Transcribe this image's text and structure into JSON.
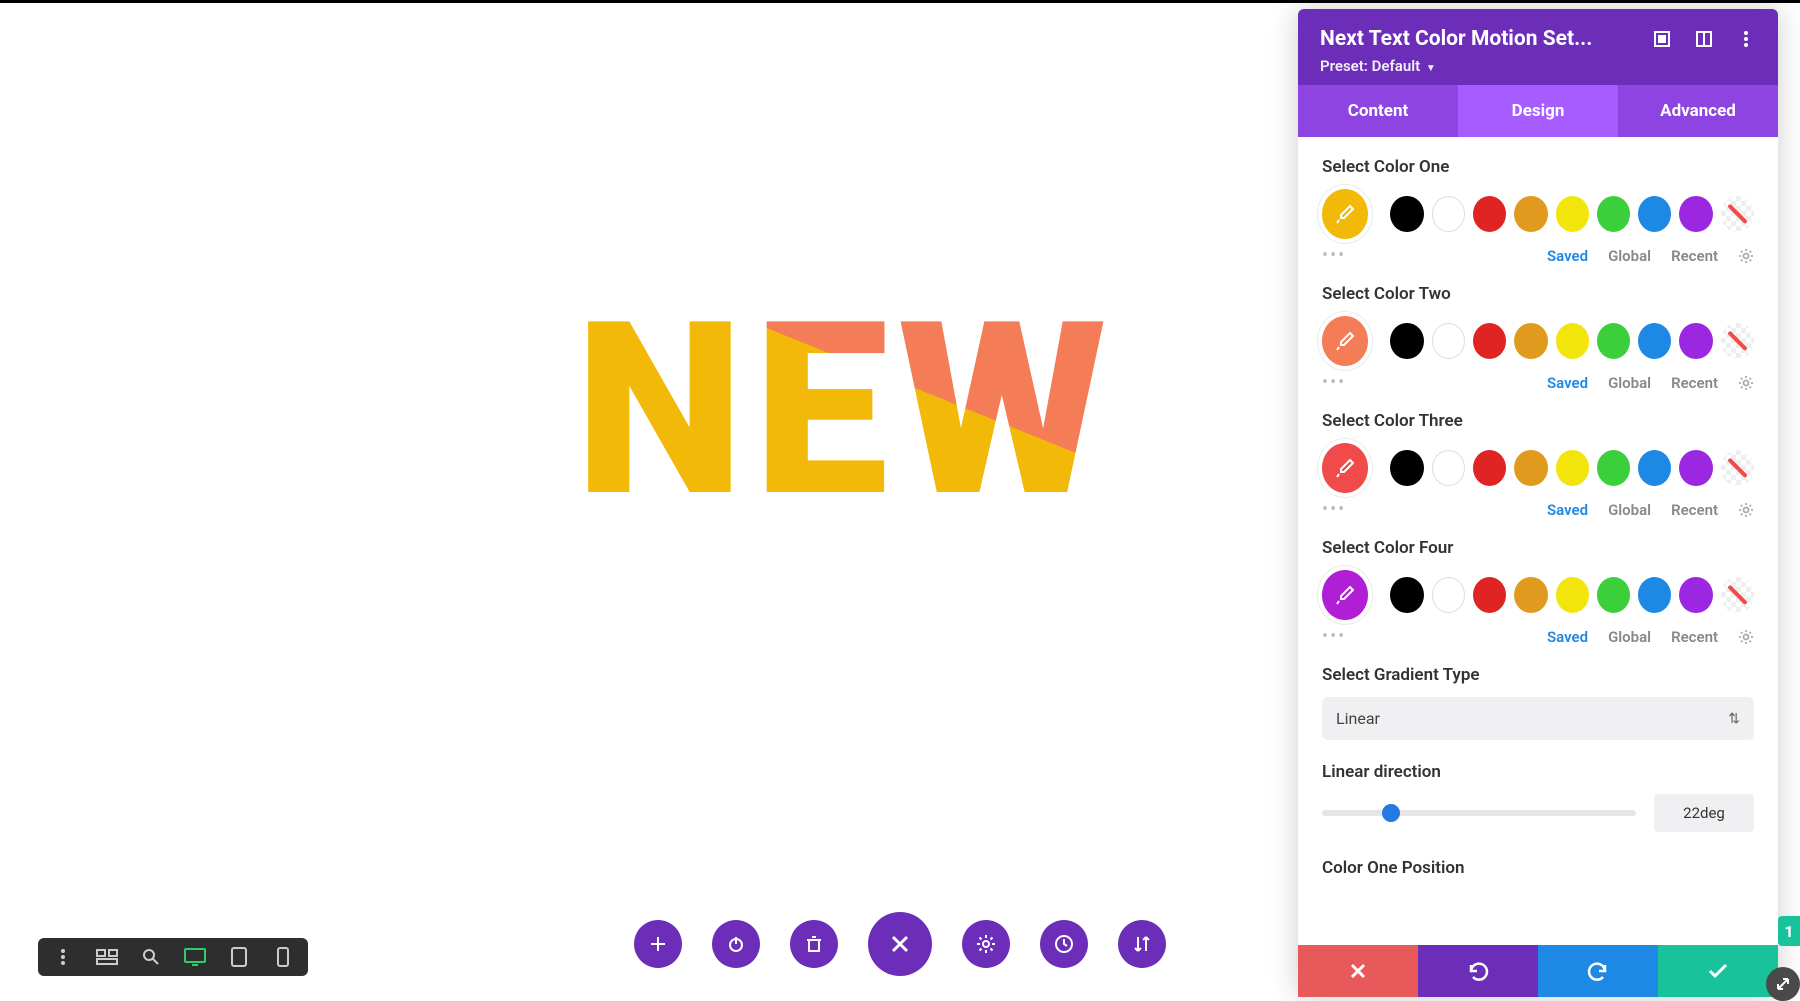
{
  "canvas": {
    "text": "NEW"
  },
  "panel": {
    "title": "Next Text Color Motion Set...",
    "preset_label": "Preset:",
    "preset_value": "Default",
    "tabs": {
      "content": "Content",
      "design": "Design",
      "advanced": "Advanced",
      "active": "design"
    },
    "sections": {
      "color1": {
        "label": "Select Color One",
        "selected": "#f2b909",
        "swatches": [
          "#000000",
          "#ffffff",
          "#e02424",
          "#e09b1e",
          "#f1e50b",
          "#3bcf3b",
          "#1e88e5",
          "#9b27e0",
          "none"
        ]
      },
      "color2": {
        "label": "Select Color Two",
        "selected": "#f47c56",
        "swatches": [
          "#000000",
          "#ffffff",
          "#e02424",
          "#e09b1e",
          "#f1e50b",
          "#3bcf3b",
          "#1e88e5",
          "#9b27e0",
          "none"
        ]
      },
      "color3": {
        "label": "Select Color Three",
        "selected": "#f04a4a",
        "swatches": [
          "#000000",
          "#ffffff",
          "#e02424",
          "#e09b1e",
          "#f1e50b",
          "#3bcf3b",
          "#1e88e5",
          "#9b27e0",
          "none"
        ]
      },
      "color4": {
        "label": "Select Color Four",
        "selected": "#b01ed6",
        "swatches": [
          "#000000",
          "#ffffff",
          "#e02424",
          "#e09b1e",
          "#f1e50b",
          "#3bcf3b",
          "#1e88e5",
          "#9b27e0",
          "none"
        ]
      },
      "gradient_type": {
        "label": "Select Gradient Type",
        "value": "Linear"
      },
      "linear_direction": {
        "label": "Linear direction",
        "value": "22deg",
        "percent": 22
      },
      "color_one_position": {
        "label": "Color One Position"
      }
    },
    "sublinks": {
      "saved": "Saved",
      "global": "Global",
      "recent": "Recent"
    }
  },
  "badge": "1"
}
